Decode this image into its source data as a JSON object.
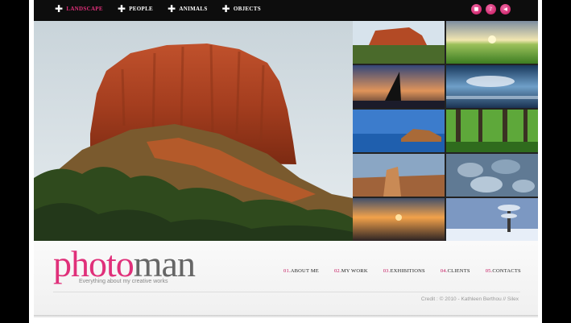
{
  "nav": {
    "items": [
      {
        "label": "LANDSCAPE",
        "active": true
      },
      {
        "label": "PEOPLE",
        "active": false
      },
      {
        "label": "ANIMALS",
        "active": false
      },
      {
        "label": "OBJECTS",
        "active": false
      }
    ]
  },
  "controls": {
    "icons": [
      "fullscreen-icon",
      "music-icon",
      "sound-icon"
    ],
    "accent": "#e0307a"
  },
  "logo": {
    "photo": "photo",
    "man": "man",
    "tagline": "Everything about my creative works"
  },
  "footer_nav": {
    "items": [
      {
        "num": "01.",
        "label": "ABOUT ME"
      },
      {
        "num": "02.",
        "label": "MY WORK"
      },
      {
        "num": "03.",
        "label": "EXHIBITIONS"
      },
      {
        "num": "04.",
        "label": "CLIENTS"
      },
      {
        "num": "05.",
        "label": "CONTACTS"
      }
    ]
  },
  "credit": "Credit : © 2010 - Kathleen Berthou // Silex"
}
